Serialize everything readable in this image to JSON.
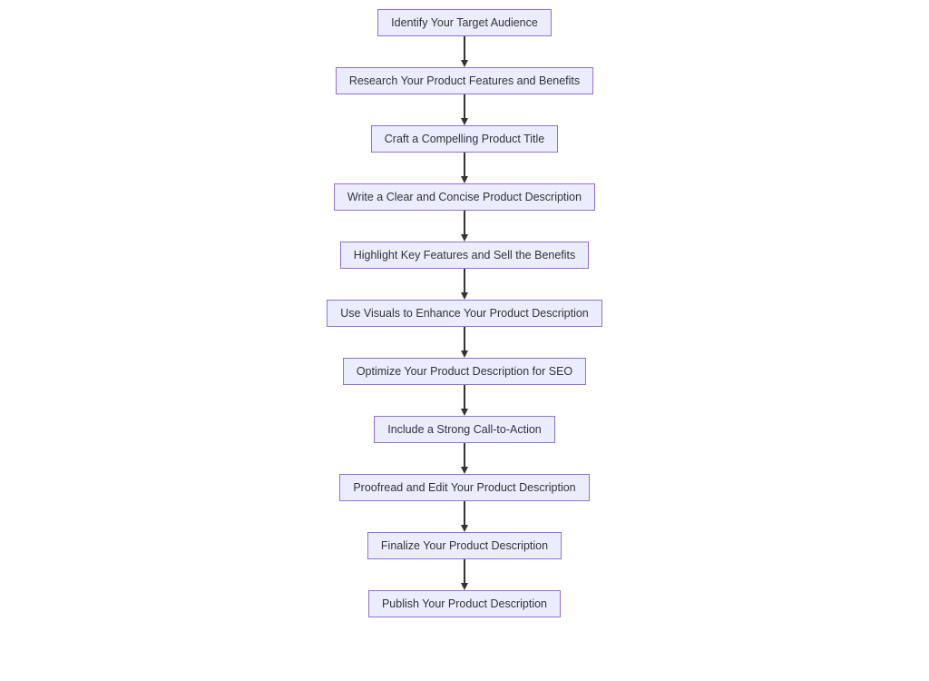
{
  "flowchart": {
    "type": "vertical-flow",
    "nodes": [
      {
        "label": "Identify Your Target Audience"
      },
      {
        "label": "Research Your Product Features and Benefits"
      },
      {
        "label": "Craft a Compelling Product Title"
      },
      {
        "label": "Write a Clear and Concise Product Description"
      },
      {
        "label": "Highlight Key Features and Sell the Benefits"
      },
      {
        "label": "Use Visuals to Enhance Your Product Description"
      },
      {
        "label": "Optimize Your Product Description for SEO"
      },
      {
        "label": "Include a Strong Call-to-Action"
      },
      {
        "label": "Proofread and Edit Your Product Description"
      },
      {
        "label": "Finalize Your Product Description"
      },
      {
        "label": "Publish Your Product Description"
      }
    ],
    "style": {
      "node_fill": "#ECECFF",
      "node_border": "#9370DB",
      "arrow_color": "#333333",
      "text_color": "#333333"
    }
  }
}
